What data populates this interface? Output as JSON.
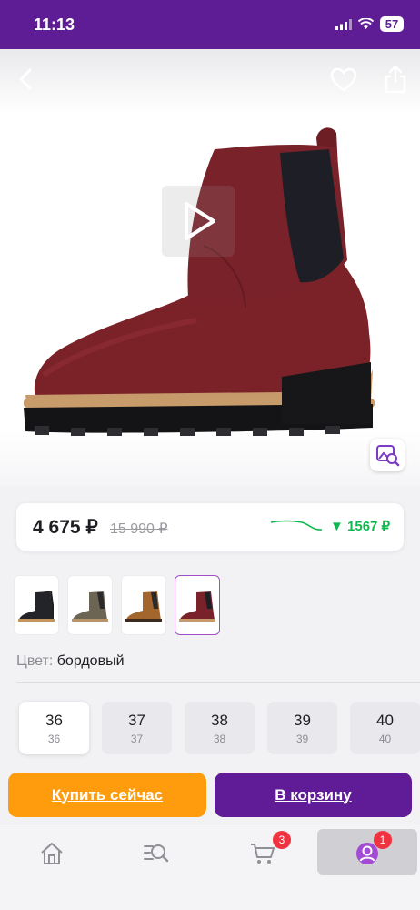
{
  "status_bar": {
    "time": "11:13",
    "battery": "57"
  },
  "price": {
    "current": "4 675 ₽",
    "old": "15 990 ₽",
    "drop": "▼ 1567 ₽"
  },
  "color": {
    "label": "Цвет:",
    "value": "бордовый"
  },
  "sizes": [
    {
      "size": "36",
      "sub": "36"
    },
    {
      "size": "37",
      "sub": "37"
    },
    {
      "size": "38",
      "sub": "38"
    },
    {
      "size": "39",
      "sub": "39"
    },
    {
      "size": "40",
      "sub": "40"
    }
  ],
  "actions": {
    "buy_now": "Купить сейчас",
    "add_to_cart": "В корзину"
  },
  "tab_bar": {
    "cart_badge": "3",
    "profile_badge": "1"
  },
  "colors": {
    "brand_purple": "#601c96",
    "buy_orange": "#ff9c0e",
    "drop_green": "#10b94f",
    "badge_red": "#ef3340"
  },
  "icons": [
    "back-icon",
    "heart-icon",
    "share-icon",
    "play-icon",
    "visual-search-icon",
    "home-icon",
    "catalog-search-icon",
    "cart-icon",
    "profile-icon"
  ]
}
